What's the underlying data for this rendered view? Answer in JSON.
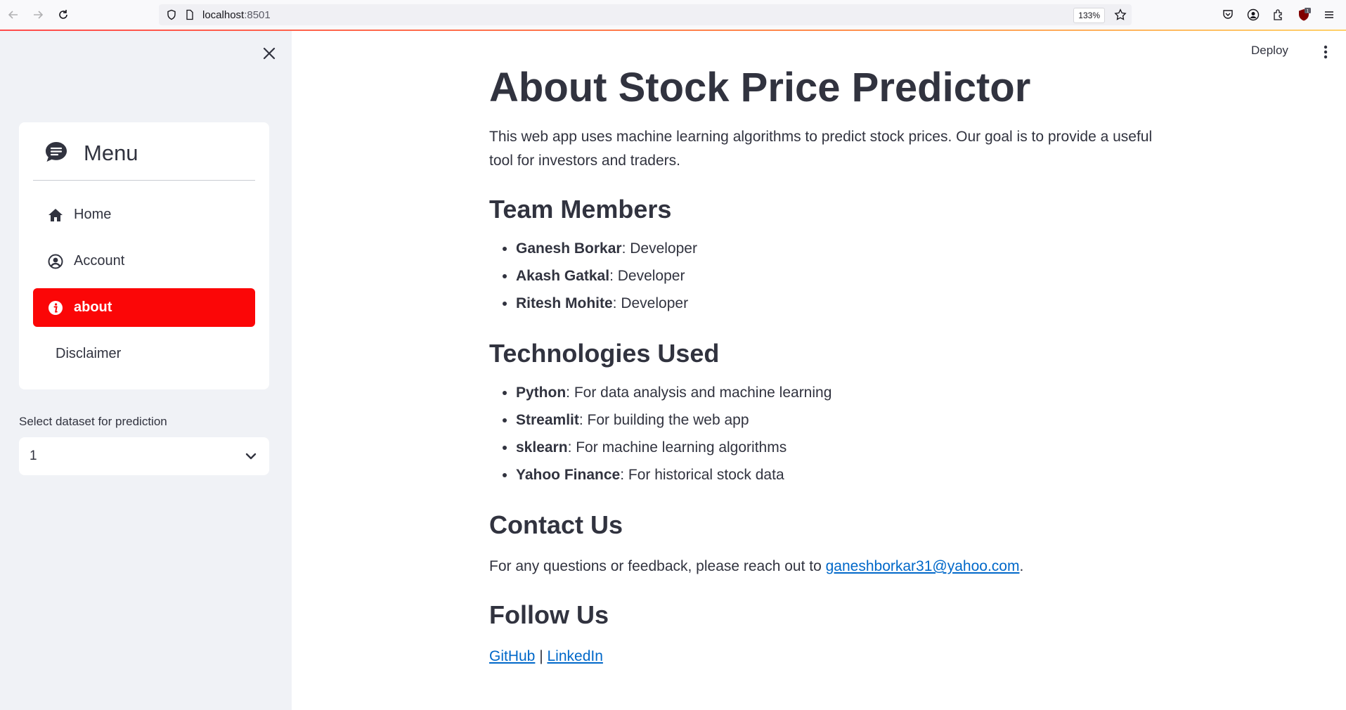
{
  "browser": {
    "url_host": "localhost",
    "url_port": ":8501",
    "zoom": "133%"
  },
  "sidebar": {
    "menu_title": "Menu",
    "items": [
      {
        "label": "Home",
        "icon": "house-icon"
      },
      {
        "label": "Account",
        "icon": "user-circle-icon"
      },
      {
        "label": "about",
        "icon": "info-icon",
        "active": true
      },
      {
        "label": "Disclaimer",
        "icon": ""
      }
    ],
    "active_color": "#fb0607",
    "select_label": "Select dataset for prediction",
    "select_value": "1"
  },
  "header": {
    "deploy_label": "Deploy"
  },
  "main": {
    "title": "About Stock Price Predictor",
    "intro": "This web app uses machine learning algorithms to predict stock prices. Our goal is to provide a useful tool for investors and traders.",
    "team_heading": "Team Members",
    "team": [
      {
        "name": "Ganesh Borkar",
        "role": ": Developer"
      },
      {
        "name": "Akash Gatkal",
        "role": ": Developer"
      },
      {
        "name": "Ritesh Mohite",
        "role": ": Developer"
      }
    ],
    "tech_heading": "Technologies Used",
    "tech": [
      {
        "name": "Python",
        "desc": ": For data analysis and machine learning"
      },
      {
        "name": "Streamlit",
        "desc": ": For building the web app"
      },
      {
        "name": "sklearn",
        "desc": ": For machine learning algorithms"
      },
      {
        "name": "Yahoo Finance",
        "desc": ": For historical stock data"
      }
    ],
    "contact_heading": "Contact Us",
    "contact_text": "For any questions or feedback, please reach out to ",
    "contact_email": "ganeshborkar31@yahoo.com",
    "contact_end": ".",
    "follow_heading": "Follow Us",
    "github_label": "GitHub",
    "separator": " | ",
    "linkedin_label": "LinkedIn",
    "link_color": "#0068c9"
  }
}
